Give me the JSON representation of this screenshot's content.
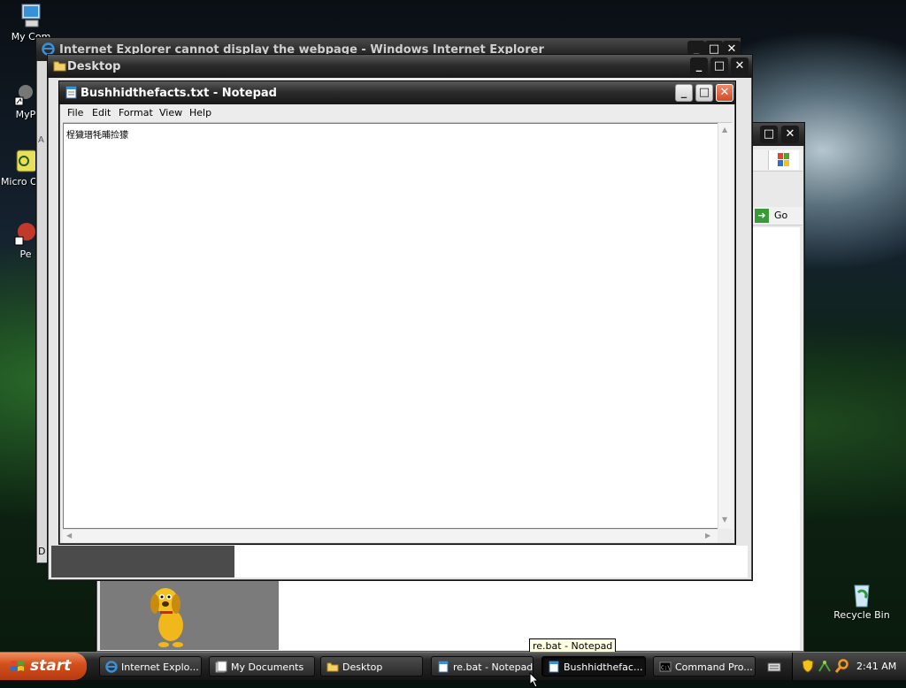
{
  "desktop": {
    "icons": [
      {
        "label": "My Com"
      },
      {
        "label": "MyP"
      },
      {
        "label": "Micro Outl"
      },
      {
        "label": "Pe"
      },
      {
        "label": "Recycle Bin"
      }
    ]
  },
  "ie_window": {
    "title": "Internet Explorer cannot display the webpage - Windows Internet Explorer",
    "go_label": "Go",
    "status_fragment": "D",
    "address_fragment": "A"
  },
  "desktop_window": {
    "title": "Desktop"
  },
  "notepad": {
    "title": "Bushhidthefacts.txt - Notepad",
    "menu": [
      "File",
      "Edit",
      "Format",
      "View",
      "Help"
    ],
    "content": "桯獩瑨牦晡捡獴"
  },
  "taskbar": {
    "start_label": "start",
    "tasks": [
      {
        "label": "Internet Explo..."
      },
      {
        "label": "My Documents"
      },
      {
        "label": "Desktop"
      },
      {
        "label": "re.bat - Notepad"
      },
      {
        "label": "Bushhidthefac..."
      },
      {
        "label": "Command Pro..."
      }
    ],
    "clock": "2:41 AM"
  },
  "tooltip": "re.bat - Notepad",
  "colors": {
    "start_button": "#d5511d",
    "close_button": "#d04a2a",
    "titlebar": "#181818"
  }
}
